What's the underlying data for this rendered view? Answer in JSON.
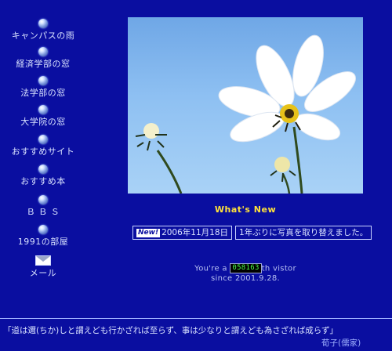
{
  "nav": {
    "items": [
      {
        "label": "キャンパスの雨",
        "icon": "orb-icon"
      },
      {
        "label": "経済学部の窓",
        "icon": "orb-icon"
      },
      {
        "label": "法学部の窓",
        "icon": "orb-icon"
      },
      {
        "label": "大学院の窓",
        "icon": "orb-icon"
      },
      {
        "label": "おすすめサイト",
        "icon": "orb-icon"
      },
      {
        "label": "おすすめ本",
        "icon": "orb-icon"
      },
      {
        "label": "Ｂ Ｂ Ｓ",
        "icon": "orb-icon"
      },
      {
        "label": "1991の部屋",
        "icon": "orb-icon"
      },
      {
        "label": "メール",
        "icon": "mail-icon"
      }
    ]
  },
  "main": {
    "whats_new": "What's New",
    "news": {
      "badge": "New!",
      "date": "2006年11月18日",
      "text": "1年ぶりに写真を取り替えました。"
    },
    "counter": {
      "prefix": "You're a",
      "value": "058163",
      "suffix": "th vistor",
      "since": "since 2001.9.28."
    }
  },
  "footer": {
    "quote": "「道は邇(ちか)しと謂えども行かざれば至らず、事は少なりと謂えども為さざれば成らず」",
    "source": "荀子(儒家)"
  },
  "colors": {
    "background": "#0a0ea0",
    "whats_new": "#ffe23a",
    "counter_digits": "#4aff4a"
  }
}
